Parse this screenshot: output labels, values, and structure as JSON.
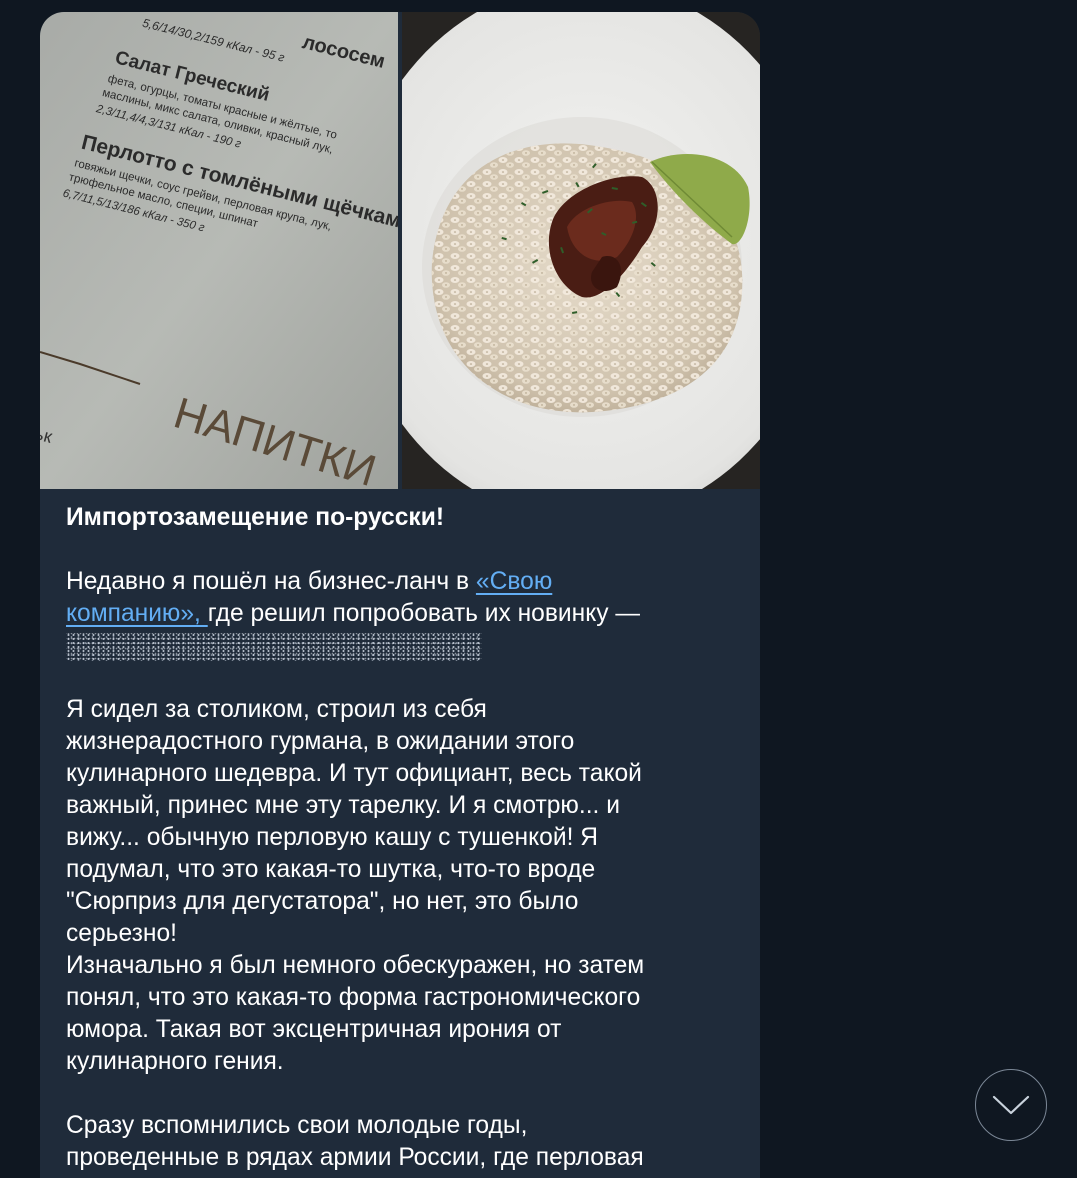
{
  "post": {
    "title": "Импортозамещение по-русски!",
    "p1": {
      "line1_text": "Недавно я пошёл на бизнес-ланч в ",
      "link_part1": "«Свою ",
      "link_part2": "компанию», ",
      "line2_text": "где решил попробовать их новинку —",
      "spoiler_hidden": true
    },
    "p2_lines": [
      "Я сидел за столиком, строил из себя",
      "жизнерадостного гурмана, в ожидании этого",
      "кулинарного шедевра. И тут официант, весь такой",
      "важный, принес мне эту тарелку. И я смотрю... и",
      "вижу... обычную перловую кашу с тушенкой! Я",
      "подумал, что это какая-то шутка, что-то вроде",
      "\"Сюрприз для дегустатора\", но нет, это было",
      "серьезно!",
      "Изначально я был немного обескуражен, но затем",
      "понял, что это какая-то форма гастрономического",
      "юмора. Такая вот эксцентричная ирония от",
      "кулинарного гения."
    ],
    "p3_lines": [
      "Сразу вспомнились свои молодые годы,",
      "проведенные в рядах армии России, где перловая"
    ]
  },
  "menu_photo": {
    "item0_info": "5,6/14/30,2/159 кКал - 95 г",
    "item0_tail": "лососем",
    "item1_name": "Салат Греческий",
    "item1_desc1": "фета, огурцы, томаты красные и жёлтые, то",
    "item1_desc2": "маслины, микс салата, оливки, красный лук,",
    "item1_info": "2,3/11,4/4,3/131 кКал - 190 г",
    "item2_name": "Перлотто с томлёными щёчками",
    "item2_desc1": "говяжьи щечки, соус грейви, перловая крупа, лук,",
    "item2_desc2": "трюфельное масло, специи, шпинат",
    "item2_info": "6,7/11,5/13/186 кКал - 350 г",
    "section": "НАПИТКИ",
    "edge_text": "ьк"
  },
  "icons": {
    "scroll_down": "chevron-down-icon"
  },
  "colors": {
    "background": "#0f1721",
    "bubble": "#1f2b3a",
    "link": "#63aef4",
    "text": "#ffffff"
  }
}
